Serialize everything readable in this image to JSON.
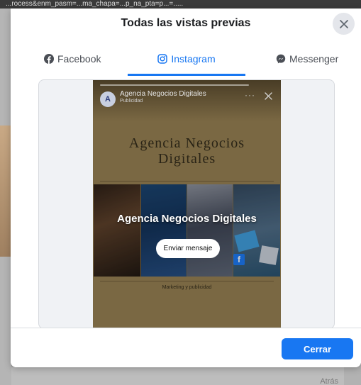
{
  "page": {
    "url_text": "...rocess&enm_pasm=...ma_chapa=...p_na_pta=p...=....."
  },
  "background": {
    "right_label": "Atrás"
  },
  "modal": {
    "title": "Todas las vistas previas",
    "close_icon": "close-icon",
    "tabs": [
      {
        "label": "Facebook",
        "icon": "facebook-icon",
        "active": false
      },
      {
        "label": "Instagram",
        "icon": "instagram-icon",
        "active": true
      },
      {
        "label": "Messenger",
        "icon": "messenger-icon",
        "active": false
      }
    ],
    "accent_color": "#1877f2",
    "footer": {
      "close_label": "Cerrar"
    }
  },
  "story": {
    "account_initial": "A",
    "account_name": "Agencia Negocios Digitales",
    "account_subtitle": "Publicidad",
    "headline_line1": "Agencia Negocios",
    "headline_line2": "Digitales",
    "overlay_title": "Agencia Negocios Digitales",
    "cta_label": "Enviar mensaje",
    "caption": "Marketing y publicidad",
    "more_icon": "more-dots-icon",
    "background_color": "#7a6843"
  }
}
